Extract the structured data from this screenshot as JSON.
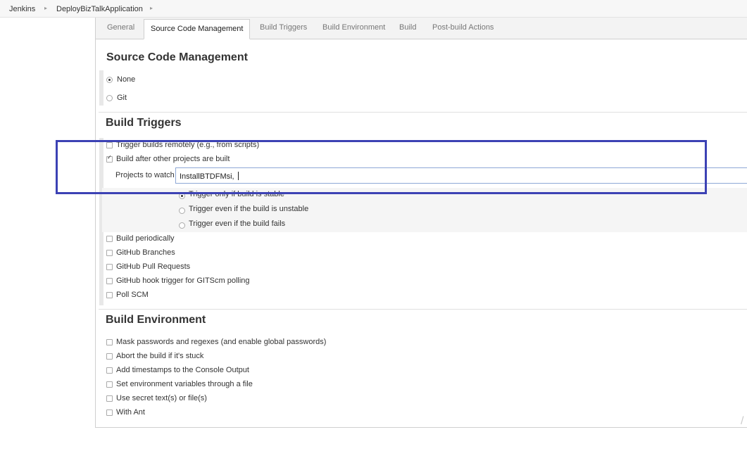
{
  "breadcrumb": {
    "items": [
      "Jenkins",
      "DeployBizTalkApplication"
    ]
  },
  "tabs": [
    "General",
    "Source Code Management",
    "Build Triggers",
    "Build Environment",
    "Build",
    "Post-build Actions"
  ],
  "scm": {
    "title": "Source Code Management",
    "options": [
      {
        "label": "None",
        "selected": true
      },
      {
        "label": "Git",
        "selected": false
      }
    ]
  },
  "triggers": {
    "title": "Build Triggers",
    "remote": {
      "label": "Trigger builds remotely (e.g., from scripts)",
      "checked": false
    },
    "after_other": {
      "label": "Build after other projects are built",
      "checked": true
    },
    "projects_label": "Projects to watch",
    "projects_value": "InstallBTDFMsi, ",
    "radio_options": [
      {
        "label": "Trigger only if build is stable",
        "selected": true
      },
      {
        "label": "Trigger even if the build is unstable",
        "selected": false
      },
      {
        "label": "Trigger even if the build fails",
        "selected": false
      }
    ],
    "more": [
      {
        "label": "Build periodically",
        "checked": false
      },
      {
        "label": "GitHub Branches",
        "checked": false
      },
      {
        "label": "GitHub Pull Requests",
        "checked": false
      },
      {
        "label": "GitHub hook trigger for GITScm polling",
        "checked": false
      },
      {
        "label": "Poll SCM",
        "checked": false
      }
    ]
  },
  "environment": {
    "title": "Build Environment",
    "options": [
      {
        "label": "Mask passwords and regexes (and enable global passwords)",
        "checked": false
      },
      {
        "label": "Abort the build if it's stuck",
        "checked": false
      },
      {
        "label": "Add timestamps to the Console Output",
        "checked": false
      },
      {
        "label": "Set environment variables through a file",
        "checked": false
      },
      {
        "label": "Use secret text(s) or file(s)",
        "checked": false
      },
      {
        "label": "With Ant",
        "checked": false
      }
    ]
  },
  "colors": {
    "highlight": "#3c42b4",
    "input_border": "#8ea8d6"
  }
}
